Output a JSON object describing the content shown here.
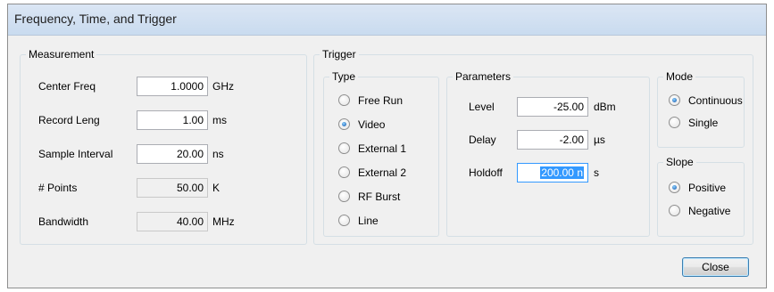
{
  "window": {
    "title": "Frequency, Time, and Trigger"
  },
  "measurement": {
    "title": "Measurement",
    "rows": [
      {
        "label": "Center Freq",
        "value": "1.0000",
        "unit": "GHz"
      },
      {
        "label": "Record Leng",
        "value": "1.00",
        "unit": "ms"
      },
      {
        "label": "Sample Interval",
        "value": "20.00",
        "unit": "ns"
      },
      {
        "label": "# Points",
        "value": "50.00",
        "unit": "K"
      },
      {
        "label": "Bandwidth",
        "value": "40.00",
        "unit": "MHz"
      }
    ]
  },
  "trigger": {
    "title": "Trigger",
    "type": {
      "title": "Type",
      "options": [
        "Free Run",
        "Video",
        "External 1",
        "External 2",
        "RF Burst",
        "Line"
      ],
      "selected": "Video"
    },
    "parameters": {
      "title": "Parameters",
      "rows": [
        {
          "label": "Level",
          "value": "-25.00",
          "unit": "dBm"
        },
        {
          "label": "Delay",
          "value": "-2.00",
          "unit": "µs"
        },
        {
          "label": "Holdoff",
          "value": "200.00 n",
          "unit": "s"
        }
      ]
    },
    "mode": {
      "title": "Mode",
      "options": [
        "Continuous",
        "Single"
      ],
      "selected": "Continuous"
    },
    "slope": {
      "title": "Slope",
      "options": [
        "Positive",
        "Negative"
      ],
      "selected": "Positive"
    }
  },
  "buttons": {
    "close": "Close"
  },
  "colors": {
    "selection": "#3399ff",
    "titlebar": "#c9dbef"
  }
}
